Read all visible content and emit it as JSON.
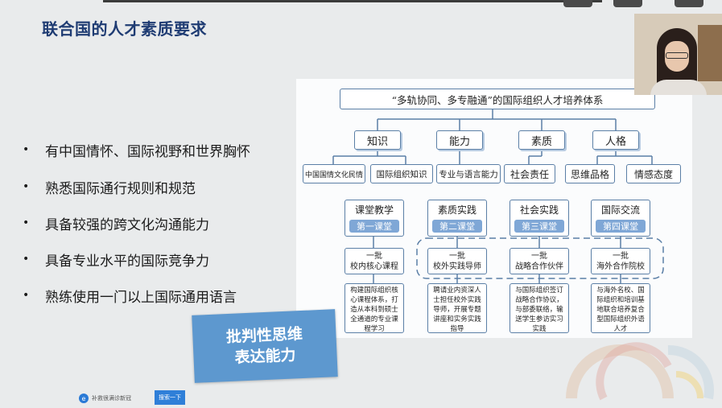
{
  "slide": {
    "title": "联合国的人才素质要求",
    "bullets": [
      "有中国情怀、国际视野和世界胸怀",
      "熟悉国际通行规则和规范",
      "具备较强的跨文化沟通能力",
      "具备专业水平的国际竞争力",
      "熟练使用一门以上国际通用语言"
    ],
    "bullet_symbol": "•"
  },
  "diagram": {
    "root": "“多轨协同、多专融通”的国际组织人才培养体系",
    "categories": [
      "知识",
      "能力",
      "素质",
      "人格"
    ],
    "attributes": [
      "中国国情文化民情",
      "国际组织知识",
      "专业与语言能力",
      "社会责任",
      "思维品格",
      "情感态度"
    ],
    "classrooms": [
      {
        "name": "课堂教学",
        "tag": "第一课堂",
        "batch": "一批\n校内核心课程",
        "desc": "构建国际组织核心课程体系，打造从本科到硕士全通道的专业课程学习"
      },
      {
        "name": "素质实践",
        "tag": "第二课堂",
        "batch": "一批\n校外实践导师",
        "desc": "聘请业内资深人士担任校外实践导师，开展专题讲座和实务实践指导"
      },
      {
        "name": "社会实践",
        "tag": "第三课堂",
        "batch": "一批\n战略合作伙伴",
        "desc": "与国际组织签订战略合作协议，与部委联络，输送学生参访实习实践"
      },
      {
        "name": "国际交流",
        "tag": "第四课堂",
        "batch": "一批\n海外合作院校",
        "desc": "与海外名校、国际组织和培训基地联合培养复合型国际组织外语人才"
      }
    ]
  },
  "callout": {
    "line1": "批判性思维",
    "line2": "表达能力",
    "color": "#5d98cf"
  },
  "taskbar": {
    "search_text": "补救很满诊新冠",
    "search_button": "搜索一下",
    "browser_icon": "ie-icon"
  },
  "colors": {
    "title": "#1f3c73",
    "diagram_border": "#5b7fa6",
    "tag_fill": "#7fa7d6"
  }
}
